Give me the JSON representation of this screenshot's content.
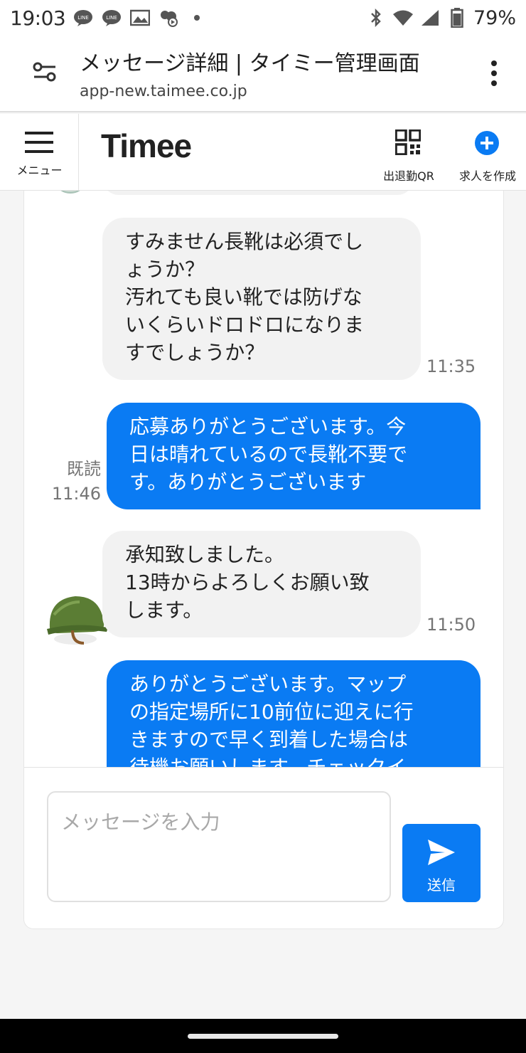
{
  "status_bar": {
    "time": "19:03",
    "icons_left": [
      "line-icon",
      "line-icon",
      "gallery-icon",
      "weather-icon"
    ],
    "icons_right": [
      "bluetooth-icon",
      "wifi-icon",
      "signal-icon",
      "battery-icon"
    ],
    "battery": "79%"
  },
  "browser": {
    "title": "メッセージ詳細 | タイミー管理画面",
    "url": "app-new.taimee.co.jp"
  },
  "header": {
    "menu_label": "メニュー",
    "logo": "Timee",
    "qr_label": "出退勤QR",
    "create_label": "求人を作成",
    "accent_color": "#0a7bf3"
  },
  "messages": [
    {
      "direction": "incoming",
      "lines": [
        "すみません長靴は必須でし",
        "ょうか？",
        "汚れても良い靴では防げな",
        "いくらいドロドロになりま",
        "すでしょうか？"
      ],
      "time": "11:35"
    },
    {
      "direction": "outgoing",
      "lines": [
        "応募ありがとうございます。今",
        "日は晴れているので長靴不要で",
        "す。ありがとうございます"
      ],
      "read_label": "既読",
      "time": "11:46"
    },
    {
      "direction": "incoming",
      "lines": [
        "承知致しました。",
        "13時からよろしくお願い致",
        "します。"
      ],
      "time": "11:50"
    },
    {
      "direction": "outgoing",
      "lines": [
        "ありがとうございます。マップ",
        "の指定場所に10前位に迎えに行",
        "きますので早く到着した場合は",
        "待機お願いします。チェックイ"
      ]
    }
  ],
  "composer": {
    "placeholder": "メッセージを入力",
    "value": "",
    "send_label": "送信"
  }
}
